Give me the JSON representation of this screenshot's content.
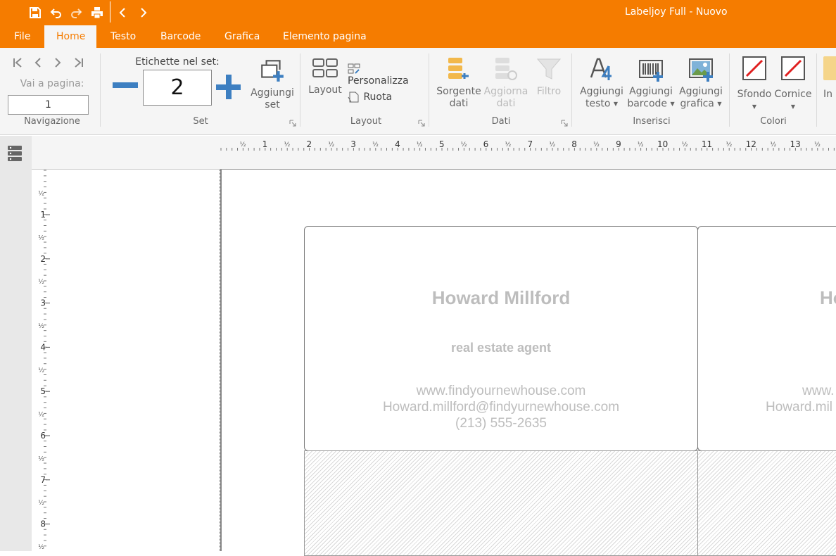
{
  "window": {
    "title": "Labeljoy Full - Nuovo"
  },
  "quick_access": [
    "save-icon",
    "undo-icon",
    "redo-icon",
    "print-icon",
    "back-icon",
    "forward-icon"
  ],
  "menu": {
    "tabs": [
      "File",
      "Home",
      "Testo",
      "Barcode",
      "Grafica",
      "Elemento pagina"
    ],
    "active": "Home"
  },
  "ribbon": {
    "navigation": {
      "page_label": "Vai a pagina:",
      "page_value": "1",
      "group": "Navigazione"
    },
    "set": {
      "count_label": "Etichette nel set:",
      "count_value": "2",
      "add_set": "Aggiungi set",
      "add_set_l1": "Aggiungi",
      "add_set_l2": "set",
      "group": "Set"
    },
    "layout": {
      "layout": "Layout",
      "customize": "Personalizza",
      "rotate": "Ruota",
      "group": "Layout"
    },
    "data": {
      "source_l1": "Sorgente",
      "source_l2": "dati",
      "update_l1": "Aggiorna",
      "update_l2": "dati",
      "filter": "Filtro",
      "group": "Dati"
    },
    "insert": {
      "text_l1": "Aggiungi",
      "text_l2": "testo",
      "barcode_l1": "Aggiungi",
      "barcode_l2": "barcode",
      "graphic_l1": "Aggiungi",
      "graphic_l2": "grafica",
      "group": "Inserisci"
    },
    "colors": {
      "background": "Sfondo",
      "border": "Cornice",
      "group": "Colori"
    },
    "more": "In"
  },
  "ruler_h": {
    "numbers": [
      "1",
      "2",
      "3",
      "4",
      "5",
      "6",
      "7",
      "8",
      "9",
      "10",
      "11",
      "12",
      "13"
    ],
    "half": "½"
  },
  "ruler_v": {
    "numbers": [
      "1",
      "2",
      "3",
      "4",
      "5",
      "6",
      "7",
      "8"
    ],
    "half": "½"
  },
  "label1": {
    "name": "Howard Millford",
    "role": "real estate agent",
    "web": "www.findyournewhouse.com",
    "email": "Howard.millford@findyurnewhouse.com",
    "phone": "(213) 555-2635"
  },
  "label2": {
    "name": "Ho",
    "web": "www.",
    "email": "Howard.mil"
  },
  "colors": {
    "accent": "#f57c00",
    "blue": "#3d7fc1"
  }
}
